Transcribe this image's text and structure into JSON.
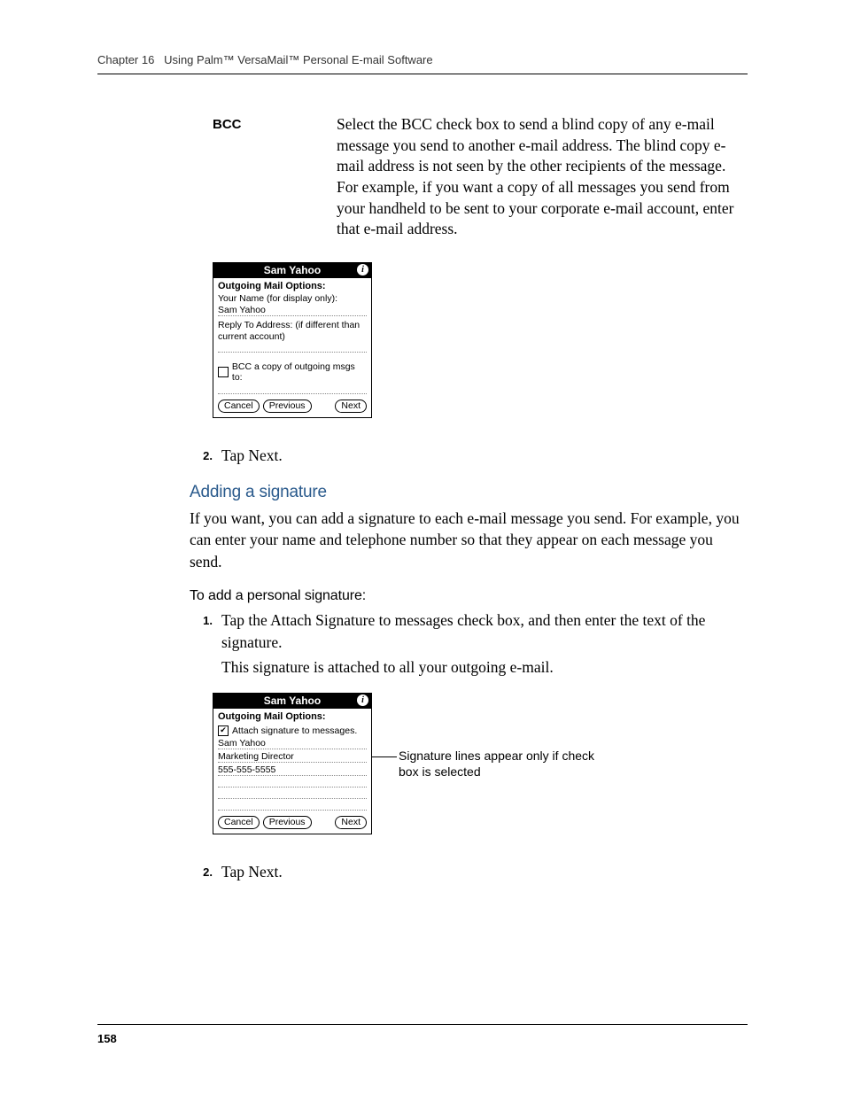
{
  "header": {
    "chapter": "Chapter 16",
    "title": "Using Palm™ VersaMail™ Personal E-mail Software"
  },
  "definition": {
    "term": "BCC",
    "body": "Select the BCC check box to send a blind copy of any e-mail message you send to another e-mail address. The blind copy e-mail address is not seen by the other recipients of the message. For example, if you want a copy of all messages you send from your handheld to be sent to your corporate e-mail account, enter that e-mail address."
  },
  "screenshot1": {
    "title": "Sam Yahoo",
    "info_icon": "i",
    "heading": "Outgoing Mail Options:",
    "label_your_name": "Your Name (for display only):",
    "value_your_name": "Sam Yahoo",
    "label_reply_to": "Reply To Address: (if different than current account)",
    "checkbox_checked": false,
    "checkbox_label": "BCC a copy of outgoing msgs to:",
    "btn_cancel": "Cancel",
    "btn_prev": "Previous",
    "btn_next": "Next"
  },
  "step2a": {
    "num": "2.",
    "text": "Tap Next."
  },
  "section": {
    "heading": "Adding a signature",
    "body": "If you want, you can add a signature to each e-mail message you send. For example, you can enter your name and telephone number so that they appear on each message you send."
  },
  "subheading": "To add a personal signature:",
  "step1b": {
    "num": "1.",
    "text": "Tap the Attach Signature to messages check box, and then enter the text of the signature.",
    "followup": "This signature is attached to all your outgoing e-mail."
  },
  "screenshot2": {
    "title": "Sam Yahoo",
    "info_icon": "i",
    "heading": "Outgoing Mail Options:",
    "checkbox_checked": true,
    "check_mark": "✔",
    "checkbox_label": "Attach signature to messages.",
    "sig_line1": "Sam Yahoo",
    "sig_line2": "Marketing Director",
    "sig_line3": "555-555-5555",
    "btn_cancel": "Cancel",
    "btn_prev": "Previous",
    "btn_next": "Next"
  },
  "callout": "Signature lines appear only if check box is selected",
  "step2b": {
    "num": "2.",
    "text": "Tap Next."
  },
  "page_number": "158"
}
